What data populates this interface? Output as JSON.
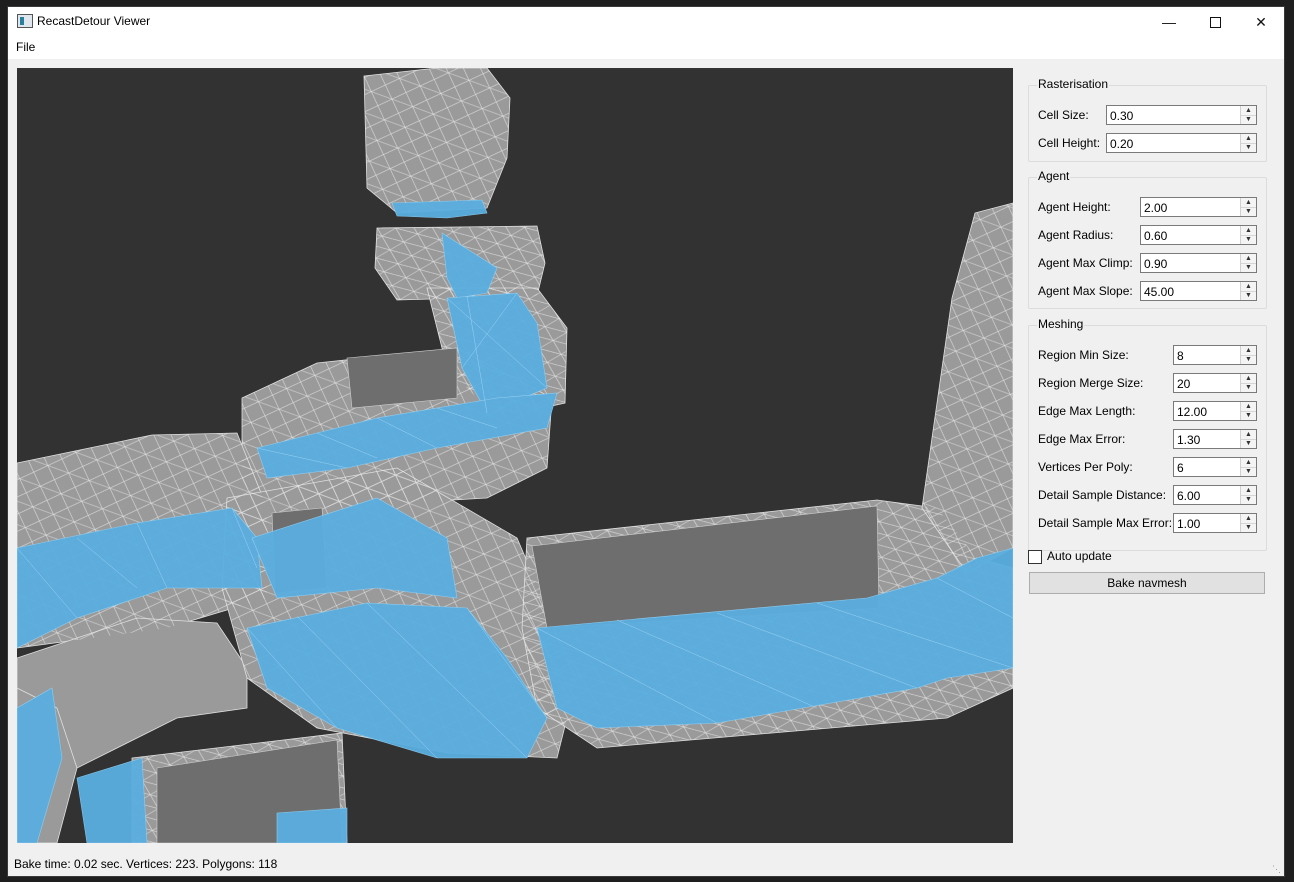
{
  "window": {
    "title": "RecastDetour Viewer",
    "icon": "app-icon"
  },
  "menu": {
    "file": "File"
  },
  "rasterisation": {
    "title": "Rasterisation",
    "fields": [
      {
        "label": "Cell Size:",
        "value": "0.30"
      },
      {
        "label": "Cell Height:",
        "value": "0.20"
      }
    ]
  },
  "agent": {
    "title": "Agent",
    "fields": [
      {
        "label": "Agent Height:",
        "value": "2.00"
      },
      {
        "label": "Agent Radius:",
        "value": "0.60"
      },
      {
        "label": "Agent Max Climp:",
        "value": "0.90"
      },
      {
        "label": "Agent Max Slope:",
        "value": "45.00"
      }
    ]
  },
  "meshing": {
    "title": "Meshing",
    "fields": [
      {
        "label": "Region Min Size:",
        "value": "8"
      },
      {
        "label": "Region Merge Size:",
        "value": "20"
      },
      {
        "label": "Edge Max Length:",
        "value": "12.00"
      },
      {
        "label": "Edge Max Error:",
        "value": "1.30"
      },
      {
        "label": "Vertices Per Poly:",
        "value": "6"
      },
      {
        "label": "Detail Sample Distance:",
        "value": "6.00"
      },
      {
        "label": "Detail Sample Max Error:",
        "value": "1.00"
      }
    ]
  },
  "auto_update": {
    "label": "Auto update",
    "checked": false
  },
  "bake_button": "Bake navmesh",
  "status": "Bake time: 0.02 sec. Vertices: 223. Polygons: 118",
  "colors": {
    "viewport_bg": "#323232",
    "geometry": "#9a9a9a",
    "navmesh": "#5aaee0"
  }
}
